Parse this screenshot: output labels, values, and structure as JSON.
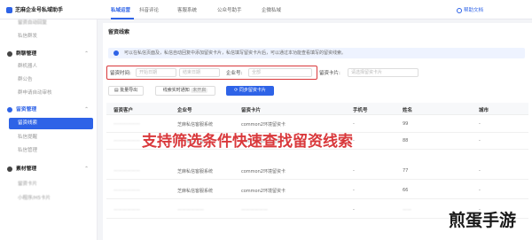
{
  "header": {
    "brand": "芝麻企业号私域助手",
    "tabs": [
      "私域运营",
      "抖音评论",
      "客服系统",
      "公众号助手",
      "企微私域"
    ],
    "active_tab": 0,
    "help": "帮助文档"
  },
  "sidebar": {
    "items": [
      {
        "type": "sub",
        "label": "留资自动回复"
      },
      {
        "type": "sub",
        "label": "私信群发"
      },
      {
        "type": "group",
        "label": "群聊管理"
      },
      {
        "type": "sub",
        "label": "群机器人"
      },
      {
        "type": "sub",
        "label": "群公告"
      },
      {
        "type": "sub",
        "label": "群申请自动审核"
      },
      {
        "type": "group",
        "label": "留资管理"
      },
      {
        "type": "sub",
        "label": "留资线索",
        "active": true
      },
      {
        "type": "sub",
        "label": "私信提醒"
      },
      {
        "type": "sub",
        "label": "私信管理"
      },
      {
        "type": "group",
        "label": "素材管理"
      },
      {
        "type": "sub",
        "label": "留资卡片"
      },
      {
        "type": "sub",
        "label": "小程序/H5卡片"
      }
    ]
  },
  "main": {
    "title": "留资线索",
    "notice": "可以在私信页面及，私信自动回复中添加留资卡片，私信填写留资卡片后，可以通过本功能查看填写的留资线索。",
    "filters": {
      "time_label": "留资时间:",
      "start_placeholder": "开始日期",
      "end_placeholder": "结束日期",
      "account_label": "企业号:",
      "account_placeholder": "全部",
      "card_label": "留资卡片:",
      "card_placeholder": "请选择留资卡片"
    },
    "actions": {
      "export": "批量导出",
      "realtime_label": "线索实时通知",
      "realtime_status": "未开启",
      "sync": "同步留资卡片"
    },
    "table": {
      "columns": [
        "留资客户",
        "企业号",
        "留资卡片",
        "手机号",
        "姓名",
        "城市"
      ],
      "rows": [
        {
          "customer": "——————",
          "account": "芝麻私信客服系统",
          "card": "common2环境留资卡",
          "phone": "-",
          "name": "99",
          "city": "-"
        },
        {
          "customer": "——————",
          "account": "芝麻私信客服系统",
          "card": "common2环境留资卡",
          "phone": "-",
          "name": "88",
          "city": "-"
        },
        {
          "customer": "——————",
          "account": "芝麻私信客服系统",
          "card": "common2环境留资卡",
          "phone": "-",
          "name": "77",
          "city": "-"
        },
        {
          "customer": "——————",
          "account": "芝麻私信客服系统",
          "card": "common2环境留资卡",
          "phone": "-",
          "name": "66",
          "city": "-"
        },
        {
          "customer": "——————",
          "account": "——————",
          "card": "——————",
          "phone": "-",
          "name": "——",
          "city": "-"
        }
      ]
    }
  },
  "overlay_caption": "支持筛选条件快速查找留资线索",
  "watermark": "煎蛋手游",
  "colors": {
    "accent": "#2e63e7",
    "highlight": "#d9383b"
  }
}
